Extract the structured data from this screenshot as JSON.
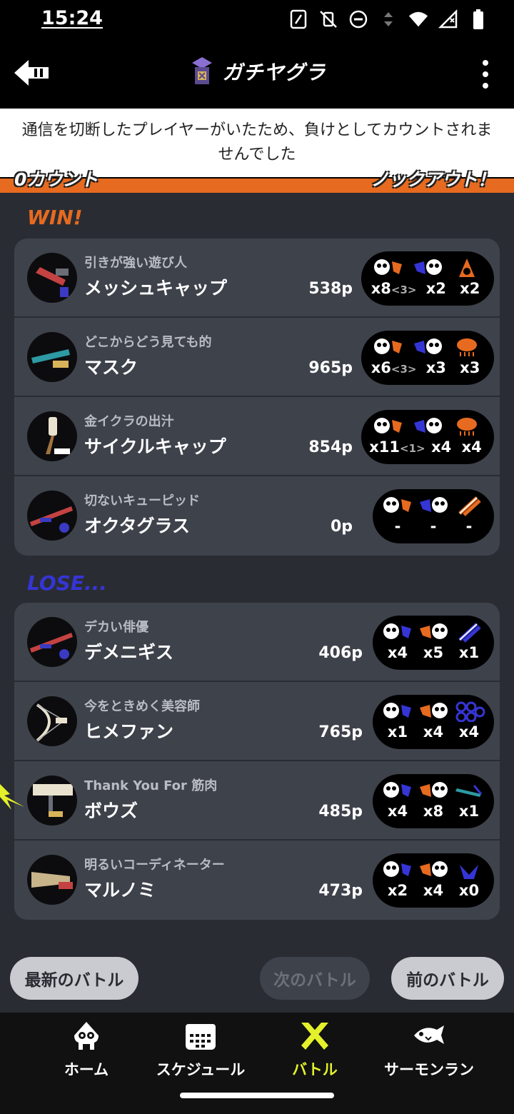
{
  "status": {
    "time": "15:24"
  },
  "header": {
    "title": "ガチヤグラ"
  },
  "notice": {
    "line1": "通信を切断したプレイヤーがいたため、負けとしてカウントされま",
    "line2": "せんでした"
  },
  "count_bar": {
    "left": "0カウント",
    "right": "ノックアウト！"
  },
  "teams": {
    "win": {
      "label": "WIN!",
      "players": [
        {
          "title": "引きが強い遊び人",
          "name": "メッシュキャップ",
          "points": "538p",
          "kills": "x8",
          "assists": "<3>",
          "deaths": "x2",
          "specials": "x2"
        },
        {
          "title": "どこからどう見ても的",
          "name": "マスク",
          "points": "965p",
          "kills": "x6",
          "assists": "<3>",
          "deaths": "x3",
          "specials": "x3"
        },
        {
          "title": "金イクラの出汁",
          "name": "サイクルキャップ",
          "points": "854p",
          "kills": "x11",
          "assists": "<1>",
          "deaths": "x4",
          "specials": "x4"
        },
        {
          "title": "切ないキューピッド",
          "name": "オクタグラス",
          "points": "0p",
          "kills": "-",
          "assists": "",
          "deaths": "-",
          "specials": "-"
        }
      ]
    },
    "lose": {
      "label": "LOSE...",
      "players": [
        {
          "title": "デカい俳優",
          "name": "デメニギス",
          "points": "406p",
          "kills": "x4",
          "assists": "",
          "deaths": "x5",
          "specials": "x1"
        },
        {
          "title": "今をときめく美容師",
          "name": "ヒメファン",
          "points": "765p",
          "kills": "x1",
          "assists": "",
          "deaths": "x4",
          "specials": "x4"
        },
        {
          "title": "Thank You For 筋肉",
          "name": "ボウズ",
          "points": "485p",
          "kills": "x4",
          "assists": "",
          "deaths": "x8",
          "specials": "x1"
        },
        {
          "title": "明るいコーディネーター",
          "name": "マルノミ",
          "points": "473p",
          "kills": "x2",
          "assists": "",
          "deaths": "x4",
          "specials": "x0"
        }
      ]
    }
  },
  "battle_nav": {
    "latest": "最新のバトル",
    "next": "次のバトル",
    "prev": "前のバトル"
  },
  "tabs": [
    {
      "label": "ホーム",
      "icon": "squid-icon"
    },
    {
      "label": "スケジュール",
      "icon": "calendar-icon"
    },
    {
      "label": "バトル",
      "icon": "battle-icon"
    },
    {
      "label": "サーモンラン",
      "icon": "salmon-icon"
    }
  ],
  "colors": {
    "win": "#e66a1f",
    "lose": "#3535d6",
    "active_tab": "#e4f12a",
    "panel": "#3e424b"
  }
}
